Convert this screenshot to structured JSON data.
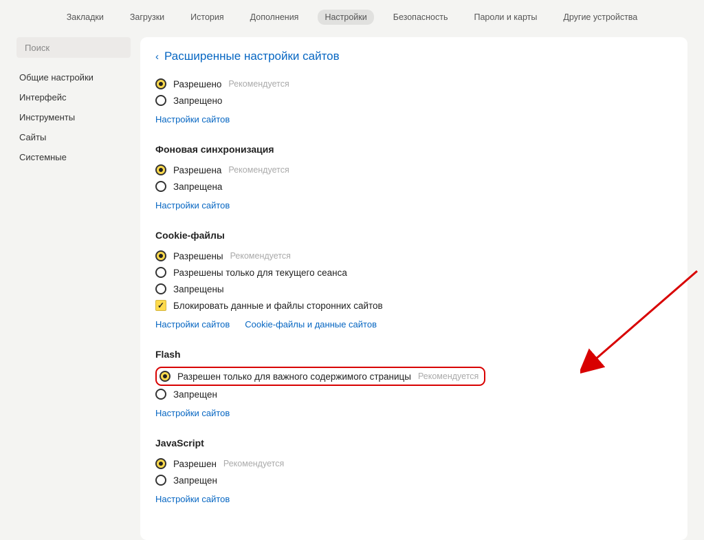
{
  "topnav": {
    "items": [
      "Закладки",
      "Загрузки",
      "История",
      "Дополнения",
      "Настройки",
      "Безопасность",
      "Пароли и карты",
      "Другие устройства"
    ],
    "activeIndex": 4
  },
  "sidebar": {
    "search_placeholder": "Поиск",
    "items": [
      "Общие настройки",
      "Интерфейс",
      "Инструменты",
      "Сайты",
      "Системные"
    ]
  },
  "breadcrumb": {
    "chevron": "‹",
    "title": "Расширенные настройки сайтов"
  },
  "recommended_text": "Рекомендуется",
  "sections": {
    "s0": {
      "opts": [
        {
          "label": "Разрешено",
          "selected": true,
          "recommended": true
        },
        {
          "label": "Запрещено",
          "selected": false
        }
      ],
      "link": "Настройки сайтов"
    },
    "bgsync": {
      "title": "Фоновая синхронизация",
      "opts": [
        {
          "label": "Разрешена",
          "selected": true,
          "recommended": true
        },
        {
          "label": "Запрещена",
          "selected": false
        }
      ],
      "link": "Настройки сайтов"
    },
    "cookies": {
      "title": "Cookie-файлы",
      "opts": [
        {
          "label": "Разрешены",
          "selected": true,
          "recommended": true
        },
        {
          "label": "Разрешены только для текущего сеанса",
          "selected": false
        },
        {
          "label": "Запрещены",
          "selected": false
        }
      ],
      "checkbox": {
        "label": "Блокировать данные и файлы сторонних сайтов",
        "checked": true
      },
      "link1": "Настройки сайтов",
      "link2": "Cookie-файлы и данные сайтов"
    },
    "flash": {
      "title": "Flash",
      "opts": [
        {
          "label": "Разрешен только для важного содержимого страницы",
          "selected": true,
          "recommended": true
        },
        {
          "label": "Запрещен",
          "selected": false
        }
      ],
      "link": "Настройки сайтов"
    },
    "js": {
      "title": "JavaScript",
      "opts": [
        {
          "label": "Разрешен",
          "selected": true,
          "recommended": true
        },
        {
          "label": "Запрещен",
          "selected": false
        }
      ],
      "link": "Настройки сайтов"
    }
  }
}
